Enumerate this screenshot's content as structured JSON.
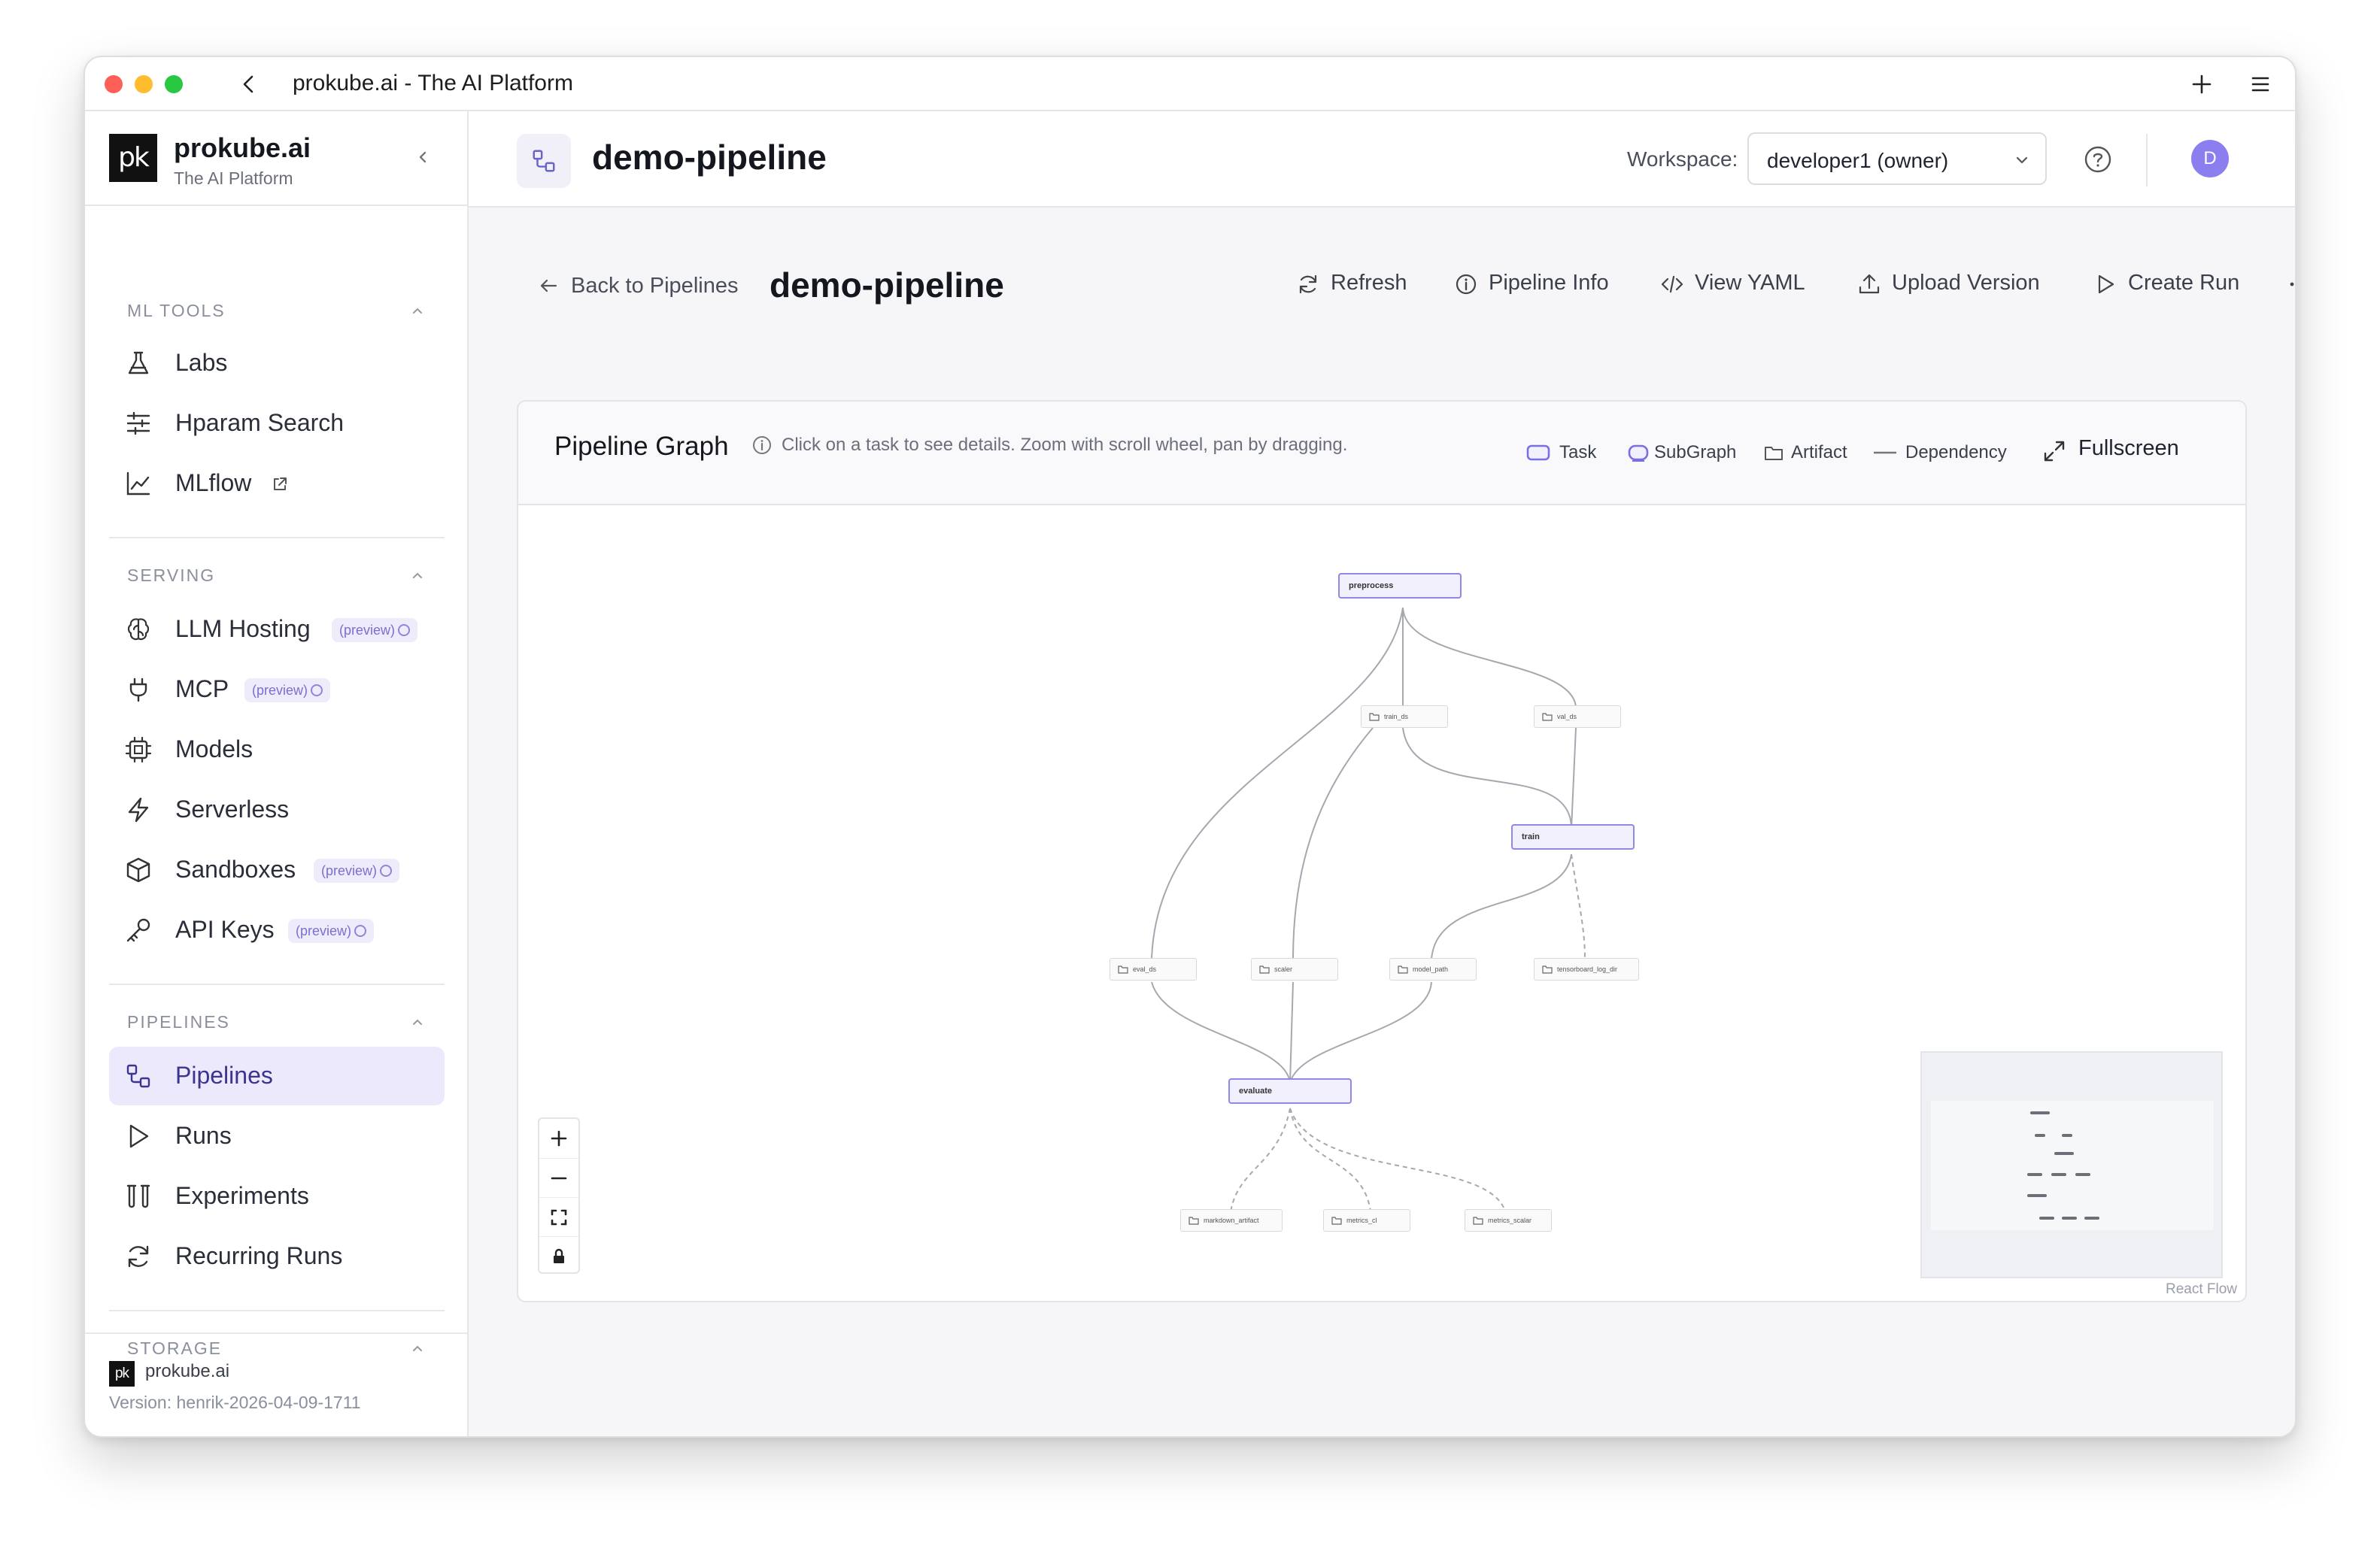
{
  "window": {
    "title": "prokube.ai - The AI Platform"
  },
  "brand": {
    "logo_text": "pk",
    "name": "prokube.ai",
    "subtitle": "The AI Platform"
  },
  "sidebar": {
    "sections": [
      {
        "label": "ML TOOLS",
        "items": [
          {
            "label": "Labs",
            "icon": "flask-icon"
          },
          {
            "label": "Hparam Search",
            "icon": "sliders-icon"
          },
          {
            "label": "MLflow",
            "icon": "chart-line-icon",
            "external": true
          }
        ]
      },
      {
        "label": "SERVING",
        "items": [
          {
            "label": "LLM Hosting",
            "icon": "brain-icon",
            "badge": "(preview)"
          },
          {
            "label": "MCP",
            "icon": "plug-icon",
            "badge": "(preview)"
          },
          {
            "label": "Models",
            "icon": "cpu-icon"
          },
          {
            "label": "Serverless",
            "icon": "zap-icon"
          },
          {
            "label": "Sandboxes",
            "icon": "box-icon",
            "badge": "(preview)"
          },
          {
            "label": "API Keys",
            "icon": "key-icon",
            "badge": "(preview)"
          }
        ]
      },
      {
        "label": "PIPELINES",
        "items": [
          {
            "label": "Pipelines",
            "icon": "workflow-icon",
            "active": true
          },
          {
            "label": "Runs",
            "icon": "play-icon"
          },
          {
            "label": "Experiments",
            "icon": "test-tubes-icon"
          },
          {
            "label": "Recurring Runs",
            "icon": "refresh-icon"
          }
        ]
      },
      {
        "label": "STORAGE",
        "items": []
      }
    ],
    "footer": {
      "logo_text": "pk",
      "name": "prokube.ai",
      "version": "Version: henrik-2026-04-09-1711"
    }
  },
  "header": {
    "title": "demo-pipeline",
    "workspace_label": "Workspace:",
    "workspace_value": "developer1 (owner)",
    "avatar_initial": "D"
  },
  "page": {
    "back_label": "Back to Pipelines",
    "title": "demo-pipeline",
    "actions": [
      "Refresh",
      "Pipeline Info",
      "View YAML",
      "Upload Version",
      "Create Run"
    ]
  },
  "graph": {
    "title": "Pipeline Graph",
    "hint": "Click on a task to see details. Zoom with scroll wheel, pan by dragging.",
    "legend": {
      "task": "Task",
      "subgraph": "SubGraph",
      "artifact": "Artifact",
      "dependency": "Dependency"
    },
    "fullscreen_label": "Fullscreen",
    "tasks": [
      "preprocess",
      "train",
      "evaluate"
    ],
    "artifacts": [
      "train_ds",
      "val_ds",
      "eval_ds",
      "scaler",
      "model_path",
      "tensorboard_log_dir",
      "markdown_artifact",
      "metrics_cl",
      "metrics_scalar"
    ],
    "attribution": "React Flow",
    "colors": {
      "accent": "#8b7ff0",
      "task_border": "#8e88e8",
      "task_fill": "#f1f0fc"
    }
  }
}
